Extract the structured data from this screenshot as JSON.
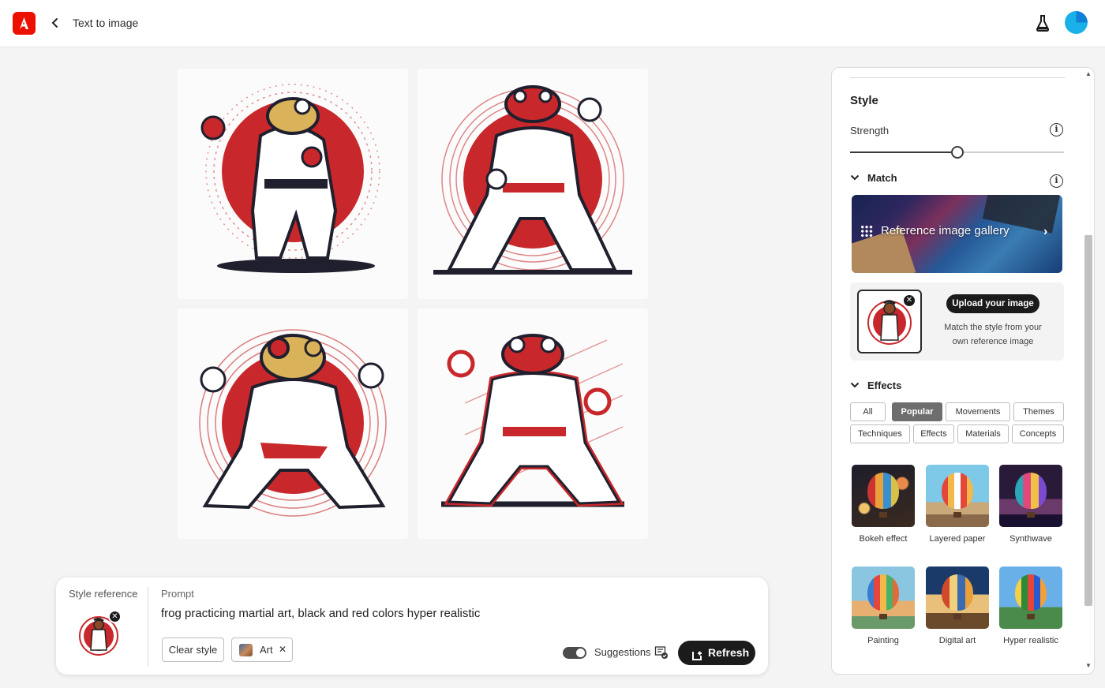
{
  "app": {
    "title": "Text to image"
  },
  "colors": {
    "brand": "#eb1000",
    "accent_dark": "#1b1b1b",
    "frog_red": "#c8282b"
  },
  "results": [
    {
      "id": "result-1"
    },
    {
      "id": "result-2"
    },
    {
      "id": "result-3"
    },
    {
      "id": "result-4"
    }
  ],
  "prompt_bar": {
    "style_reference_label": "Style reference",
    "prompt_label": "Prompt",
    "prompt_text": "frog practicing martial art, black and red colors hyper realistic",
    "clear_style_label": "Clear style",
    "art_chip_label": "Art",
    "suggestions_label": "Suggestions",
    "suggestions_on": true,
    "refresh_label": "Refresh"
  },
  "panel": {
    "style_heading": "Style",
    "strength_label": "Strength",
    "strength_value": 0.5,
    "match_label": "Match",
    "gallery_label": "Reference image gallery",
    "upload_button": "Upload your image",
    "upload_desc": "Match the style from your own reference image",
    "effects_label": "Effects",
    "effect_tabs": [
      "All",
      "Popular",
      "Movements",
      "Themes",
      "Techniques",
      "Effects",
      "Materials",
      "Concepts"
    ],
    "active_tab": "Popular",
    "effects": [
      {
        "label": "Bokeh effect"
      },
      {
        "label": "Layered paper"
      },
      {
        "label": "Synthwave"
      },
      {
        "label": "Painting"
      },
      {
        "label": "Digital art"
      },
      {
        "label": "Hyper realistic"
      }
    ]
  },
  "icons": {
    "back": "chevron-left-icon",
    "flask": "flask-icon",
    "info": "info-icon",
    "expand": "chevron-down-icon",
    "gallery": "grid-icon",
    "arrow": "chevron-right-icon",
    "close": "close-icon",
    "refresh": "refresh-icon"
  }
}
